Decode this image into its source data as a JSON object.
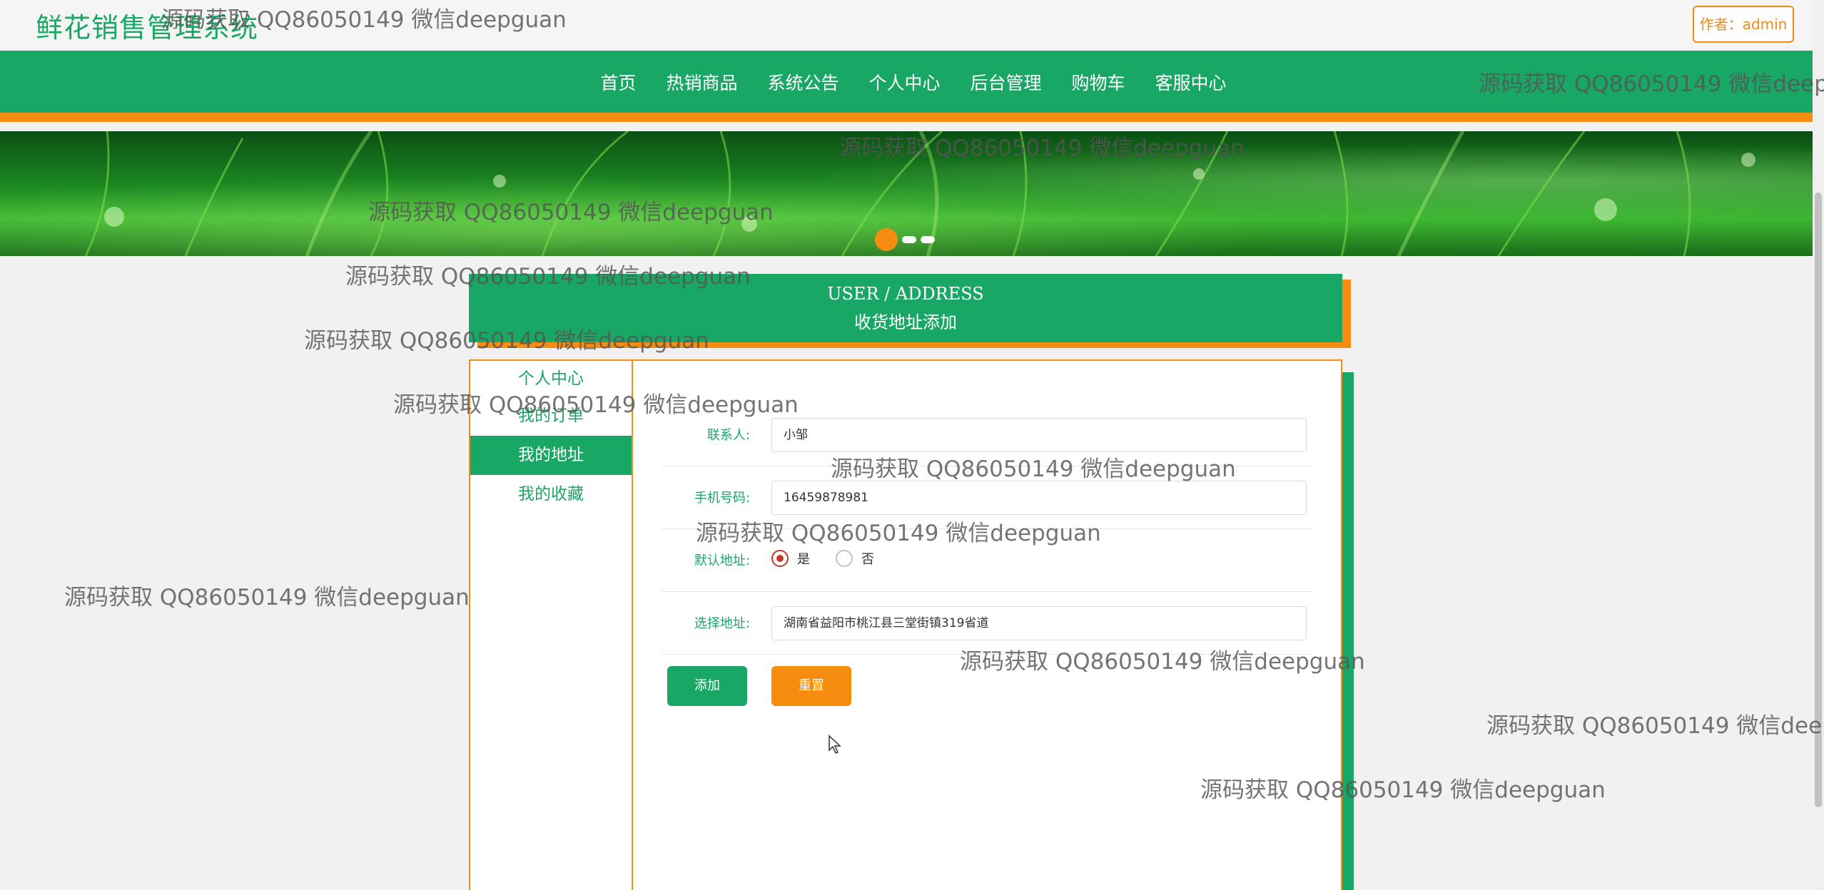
{
  "header": {
    "brand": "鲜花销售管理系统",
    "author_badge": "作者：admin"
  },
  "nav": {
    "items": [
      "首页",
      "热销商品",
      "系统公告",
      "个人中心",
      "后台管理",
      "购物车",
      "客服中心"
    ]
  },
  "banner": {
    "slides": 3,
    "active_slide": 1
  },
  "section": {
    "title_en": "USER / ADDRESS",
    "title_zh": "收货地址添加"
  },
  "sidebar": {
    "items": [
      {
        "label": "个人中心",
        "active": false
      },
      {
        "label": "我的订单",
        "active": false
      },
      {
        "label": "我的地址",
        "active": true
      },
      {
        "label": "我的收藏",
        "active": false
      }
    ]
  },
  "form": {
    "contact_label": "联系人:",
    "contact_value": "小邹",
    "phone_label": "手机号码:",
    "phone_value": "16459878981",
    "default_label": "默认地址:",
    "default_options": [
      "是",
      "否"
    ],
    "default_selected": "是",
    "address_label": "选择地址:",
    "address_value": "湖南省益阳市桃江县三堂街镇319省道",
    "add_button": "添加",
    "reset_button": "重置"
  },
  "watermark": {
    "text": "源码获取 QQ86050149 微信deepguan"
  },
  "colors": {
    "primary_green": "#18a765",
    "accent_orange": "#f68d10"
  }
}
